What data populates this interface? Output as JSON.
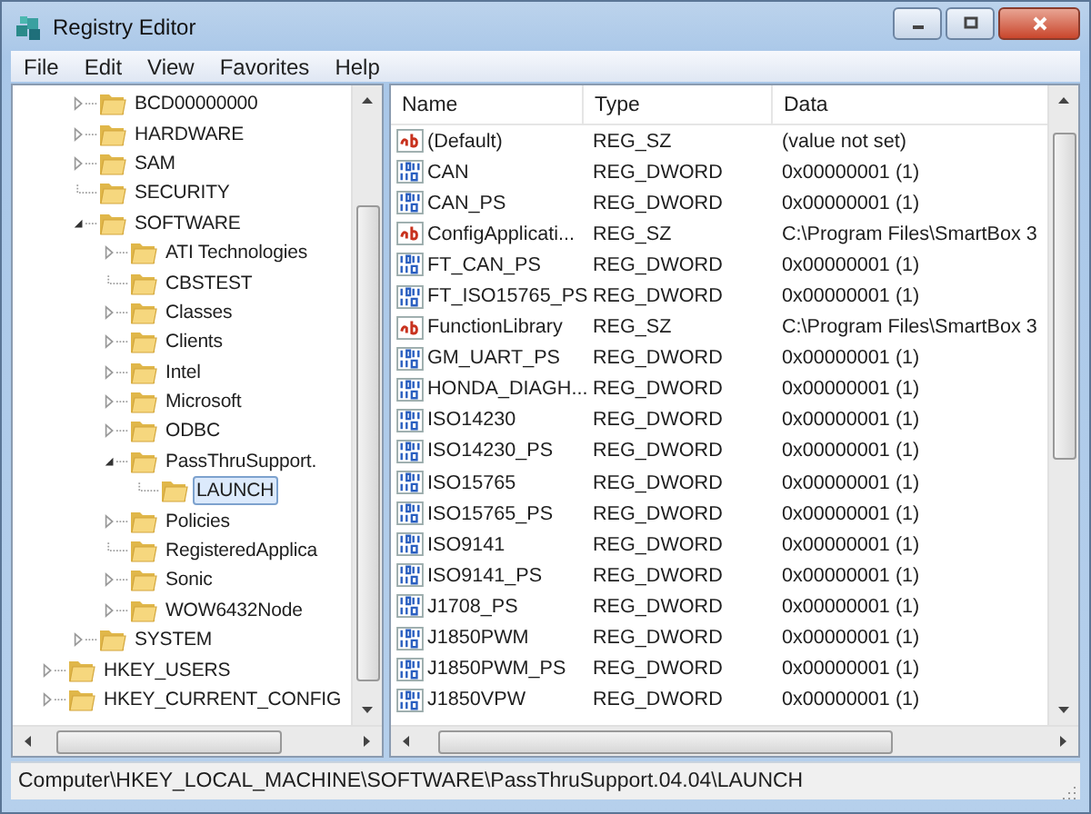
{
  "window": {
    "title": "Registry Editor"
  },
  "menu": [
    "File",
    "Edit",
    "View",
    "Favorites",
    "Help"
  ],
  "tree": {
    "continued_children": [
      {
        "label": "BCD00000000",
        "kind": "key",
        "expanded": false,
        "selected": false
      },
      {
        "label": "HARDWARE",
        "kind": "key",
        "expanded": false,
        "selected": false
      },
      {
        "label": "SAM",
        "kind": "key",
        "expanded": false,
        "selected": false
      },
      {
        "label": "SECURITY",
        "kind": "leaf",
        "selected": false
      },
      {
        "label": "SOFTWARE",
        "kind": "key",
        "expanded": true,
        "selected": false,
        "children": [
          {
            "label": "ATI Technologies",
            "kind": "key",
            "expanded": false,
            "selected": false
          },
          {
            "label": "CBSTEST",
            "kind": "leaf",
            "selected": false
          },
          {
            "label": "Classes",
            "kind": "key",
            "expanded": false,
            "selected": false
          },
          {
            "label": "Clients",
            "kind": "key",
            "expanded": false,
            "selected": false
          },
          {
            "label": "Intel",
            "kind": "key",
            "expanded": false,
            "selected": false
          },
          {
            "label": "Microsoft",
            "kind": "key",
            "expanded": false,
            "selected": false
          },
          {
            "label": "ODBC",
            "kind": "key",
            "expanded": false,
            "selected": false
          },
          {
            "label": "PassThruSupport.",
            "kind": "key",
            "expanded": true,
            "selected": false,
            "children": [
              {
                "label": "LAUNCH",
                "kind": "leaf",
                "selected": true
              }
            ]
          },
          {
            "label": "Policies",
            "kind": "key",
            "expanded": false,
            "selected": false
          },
          {
            "label": "RegisteredApplica",
            "kind": "leaf",
            "selected": false
          },
          {
            "label": "Sonic",
            "kind": "key",
            "expanded": false,
            "selected": false
          },
          {
            "label": "WOW6432Node",
            "kind": "key",
            "expanded": false,
            "selected": false
          }
        ]
      },
      {
        "label": "SYSTEM",
        "kind": "key",
        "expanded": false,
        "selected": false
      }
    ],
    "items": [
      {
        "label": "HKEY_USERS",
        "kind": "key",
        "expanded": false,
        "selected": false
      },
      {
        "label": "HKEY_CURRENT_CONFIG",
        "kind": "key",
        "expanded": false,
        "selected": false
      }
    ]
  },
  "table": {
    "columns": [
      "Name",
      "Type",
      "Data"
    ],
    "rows": [
      {
        "kind": "string",
        "name": "(Default)",
        "type": "REG_SZ",
        "data": "(value not set)"
      },
      {
        "kind": "dword",
        "name": "CAN",
        "type": "REG_DWORD",
        "data": "0x00000001 (1)"
      },
      {
        "kind": "dword",
        "name": "CAN_PS",
        "type": "REG_DWORD",
        "data": "0x00000001 (1)"
      },
      {
        "kind": "string",
        "name": "ConfigApplicati...",
        "type": "REG_SZ",
        "data": "C:\\Program Files\\SmartBox 3"
      },
      {
        "kind": "dword",
        "name": "FT_CAN_PS",
        "type": "REG_DWORD",
        "data": "0x00000001 (1)"
      },
      {
        "kind": "dword",
        "name": "FT_ISO15765_PS",
        "type": "REG_DWORD",
        "data": "0x00000001 (1)"
      },
      {
        "kind": "string",
        "name": "FunctionLibrary",
        "type": "REG_SZ",
        "data": "C:\\Program Files\\SmartBox 3"
      },
      {
        "kind": "dword",
        "name": "GM_UART_PS",
        "type": "REG_DWORD",
        "data": "0x00000001 (1)"
      },
      {
        "kind": "dword",
        "name": "HONDA_DIAGH...",
        "type": "REG_DWORD",
        "data": "0x00000001 (1)"
      },
      {
        "kind": "dword",
        "name": "ISO14230",
        "type": "REG_DWORD",
        "data": "0x00000001 (1)"
      },
      {
        "kind": "dword",
        "name": "ISO14230_PS",
        "type": "REG_DWORD",
        "data": "0x00000001 (1)"
      },
      {
        "kind": "dword",
        "name": "ISO15765",
        "type": "REG_DWORD",
        "data": "0x00000001 (1)"
      },
      {
        "kind": "dword",
        "name": "ISO15765_PS",
        "type": "REG_DWORD",
        "data": "0x00000001 (1)"
      },
      {
        "kind": "dword",
        "name": "ISO9141",
        "type": "REG_DWORD",
        "data": "0x00000001 (1)"
      },
      {
        "kind": "dword",
        "name": "ISO9141_PS",
        "type": "REG_DWORD",
        "data": "0x00000001 (1)"
      },
      {
        "kind": "dword",
        "name": "J1708_PS",
        "type": "REG_DWORD",
        "data": "0x00000001 (1)"
      },
      {
        "kind": "dword",
        "name": "J1850PWM",
        "type": "REG_DWORD",
        "data": "0x00000001 (1)"
      },
      {
        "kind": "dword",
        "name": "J1850PWM_PS",
        "type": "REG_DWORD",
        "data": "0x00000001 (1)"
      },
      {
        "kind": "dword",
        "name": "J1850VPW",
        "type": "REG_DWORD",
        "data": "0x00000001 (1)"
      }
    ]
  },
  "status_bar": "Computer\\HKEY_LOCAL_MACHINE\\SOFTWARE\\PassThruSupport.04.04\\LAUNCH"
}
